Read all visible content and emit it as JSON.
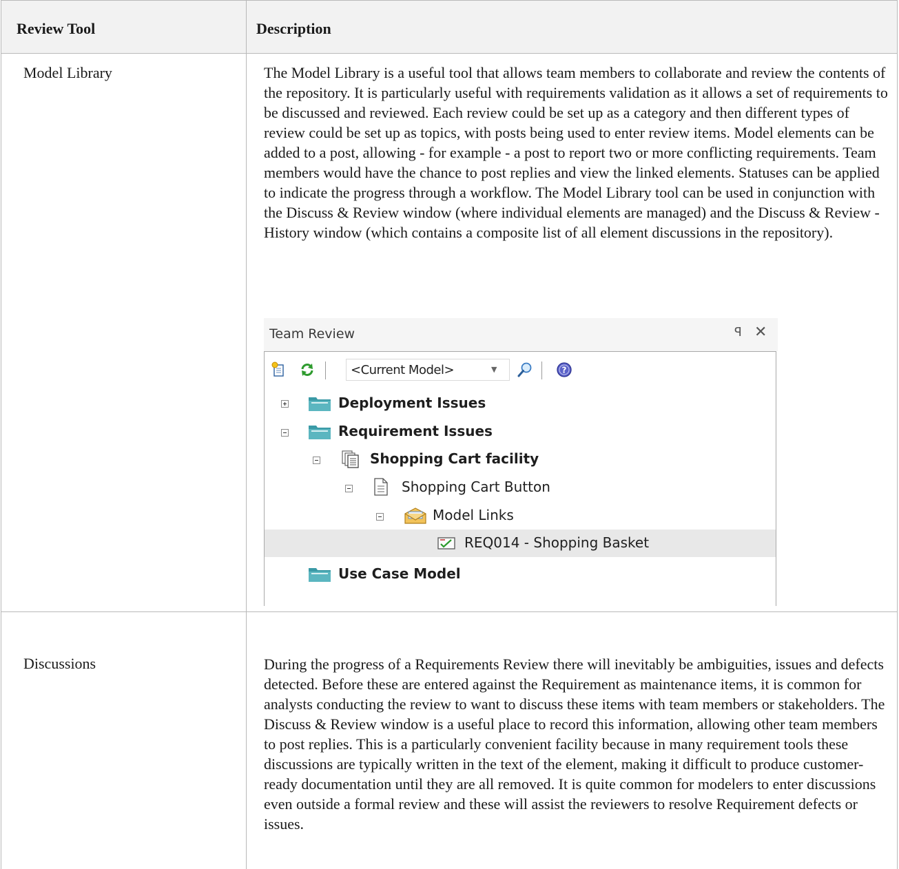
{
  "table": {
    "headers": [
      "Review Tool",
      "Description"
    ],
    "rows": [
      {
        "tool": "Model Library",
        "description": "The Model Library is a useful tool that allows team members to collaborate and review the contents of the repository. It is particularly useful with requirements validation as it allows a set of requirements to be discussed and reviewed. Each review could be set up as a category and then different types of review could be set up as topics, with posts being used to enter review items. Model elements can be added to a post, allowing - for example - a post to report two or more conflicting requirements. Team members would have the chance to post replies and view the linked elements. Statuses can be applied to indicate the progress through a workflow. The Model Library tool can be used in conjunction with the Discuss & Review window (where individual elements are managed) and the Discuss & Review - History window (which contains a composite list of all element discussions in the repository)."
      },
      {
        "tool": "Discussions",
        "description": "During the progress of a Requirements Review there will inevitably be ambiguities, issues and defects detected. Before these are entered against the Requirement as maintenance items, it is common for analysts conducting the review to want to discuss these items with team members or stakeholders. The Discuss & Review window is a useful place to record this information, allowing other team members to post replies. This is a particularly convenient facility because in many requirement tools these discussions are typically written in the text of the element, making it difficult to produce customer-ready documentation until they are all removed. It is quite common for modelers to enter discussions even outside a formal review and these will assist the reviewers to resolve Requirement defects or issues."
      }
    ]
  },
  "team_review": {
    "title": "Team Review",
    "pin_glyph": "ꟼ",
    "close_glyph": "✕",
    "toolbar": {
      "combo_value": "<Current Model>",
      "icons": [
        "new-post-icon",
        "refresh-icon",
        "search-icon",
        "help-icon"
      ]
    },
    "tree": [
      {
        "label": "Deployment Issues",
        "level": 0,
        "toggle": "plus",
        "icon": "folder-icon",
        "bold": true
      },
      {
        "label": "Requirement Issues",
        "level": 0,
        "toggle": "minus",
        "icon": "folder-icon",
        "bold": true
      },
      {
        "label": "Shopping Cart facility",
        "level": 1,
        "toggle": "minus",
        "icon": "topic-icon",
        "bold": true
      },
      {
        "label": "Shopping Cart Button",
        "level": 2,
        "toggle": "minus",
        "icon": "post-icon",
        "bold": false
      },
      {
        "label": "Model Links",
        "level": 3,
        "toggle": "minus",
        "icon": "model-links-icon",
        "bold": false
      },
      {
        "label": "REQ014 - Shopping Basket",
        "level": 4,
        "toggle": "",
        "icon": "requirement-icon",
        "bold": false,
        "selected": true
      },
      {
        "label": "Use Case Model",
        "level": 0,
        "toggle": "",
        "icon": "folder-icon",
        "bold": true
      }
    ]
  }
}
